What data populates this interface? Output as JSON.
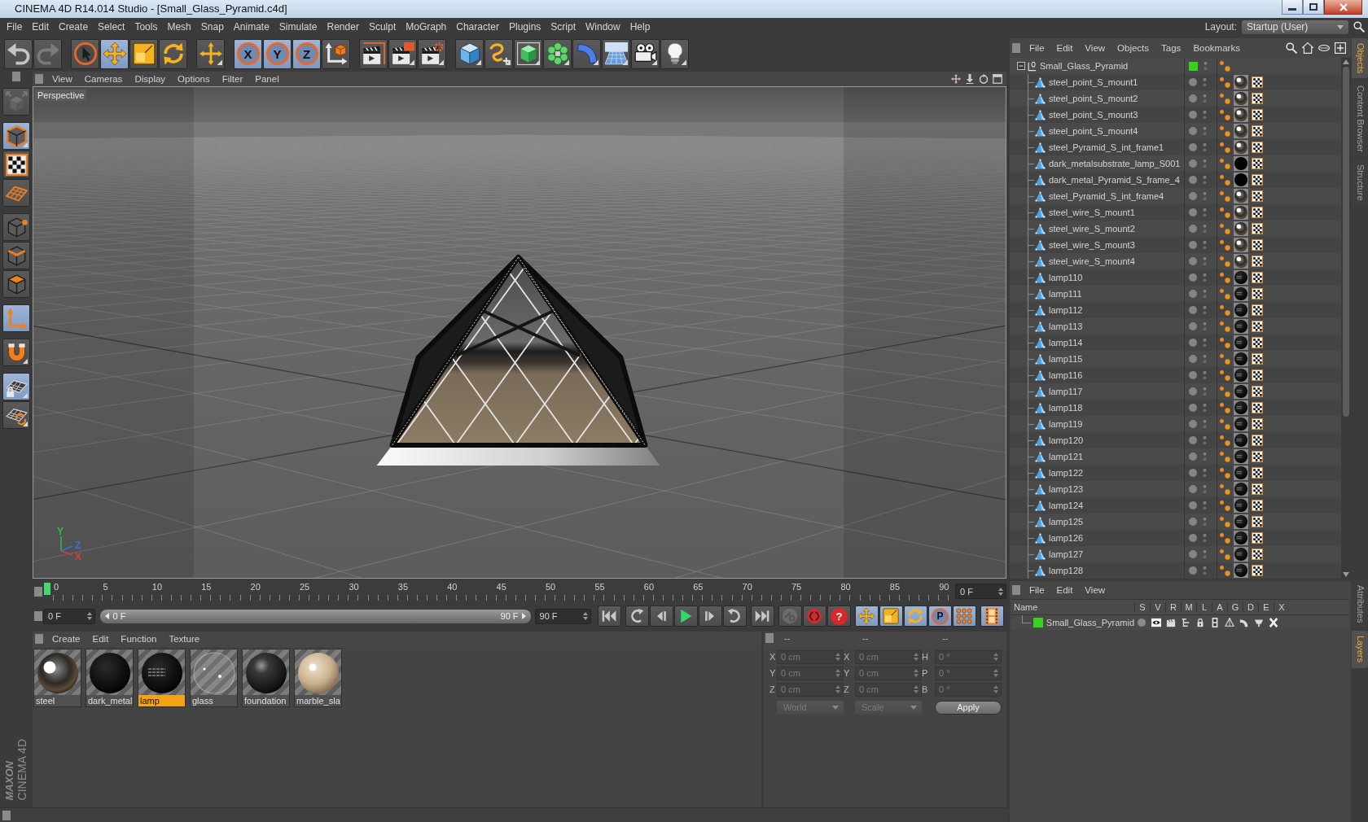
{
  "window": {
    "title": "CINEMA 4D R14.014 Studio - [Small_Glass_Pyramid.c4d]",
    "controls": [
      {
        "kind": "minimize"
      },
      {
        "kind": "maximize"
      },
      {
        "kind": "close"
      }
    ]
  },
  "menu_bar": [
    "File",
    "Edit",
    "Create",
    "Select",
    "Tools",
    "Mesh",
    "Snap",
    "Animate",
    "Simulate",
    "Render",
    "Sculpt",
    "MoGraph",
    "Character",
    "Plugins",
    "Script",
    "Window",
    "Help"
  ],
  "layout": {
    "label": "Layout:",
    "value": "Startup (User)"
  },
  "toolbar": [
    {
      "buttons": [
        {
          "kind": "undo",
          "active": false,
          "disabled": false
        },
        {
          "kind": "redo",
          "active": false,
          "disabled": true
        }
      ]
    },
    {
      "buttons": [
        {
          "kind": "select",
          "active": false,
          "disabled": false
        },
        {
          "kind": "move",
          "active": true,
          "disabled": false
        },
        {
          "kind": "scale",
          "active": false,
          "disabled": false
        },
        {
          "kind": "rotate",
          "active": false,
          "disabled": false
        }
      ]
    },
    {
      "buttons": [
        {
          "kind": "cross",
          "active": false,
          "disabled": false
        }
      ]
    },
    {
      "buttons": [
        {
          "kind": "axis",
          "label": "X",
          "active": true,
          "disabled": false
        },
        {
          "kind": "axis",
          "label": "Y",
          "active": true,
          "disabled": false
        },
        {
          "kind": "axis",
          "label": "Z",
          "active": true,
          "disabled": false
        },
        {
          "kind": "coords",
          "active": false,
          "disabled": false
        }
      ]
    },
    {
      "buttons": [
        {
          "kind": "renderview",
          "active": false,
          "disabled": false
        },
        {
          "kind": "renderpv",
          "active": false,
          "disabled": false
        },
        {
          "kind": "rendersettings",
          "active": false,
          "disabled": false
        }
      ]
    },
    {
      "buttons": [
        {
          "kind": "cube",
          "active": false,
          "disabled": false
        },
        {
          "kind": "pen",
          "active": false,
          "disabled": false
        },
        {
          "kind": "subdiv",
          "active": false,
          "disabled": false
        },
        {
          "kind": "cloner",
          "active": false,
          "disabled": false
        },
        {
          "kind": "bend",
          "active": false,
          "disabled": false
        },
        {
          "kind": "floor",
          "active": false,
          "disabled": false
        },
        {
          "kind": "camera",
          "active": false,
          "disabled": false
        },
        {
          "kind": "light",
          "active": false,
          "disabled": false
        }
      ]
    }
  ],
  "tools": [
    {
      "buttons": [
        {
          "kind": "editable",
          "active": false,
          "disabled": true
        }
      ]
    },
    {
      "buttons": [
        {
          "kind": "model",
          "active": true,
          "disabled": false
        },
        {
          "kind": "texture",
          "active": false,
          "disabled": false
        },
        {
          "kind": "workplane",
          "active": false,
          "disabled": false
        }
      ]
    },
    {
      "buttons": [
        {
          "kind": "points",
          "active": false,
          "disabled": false
        },
        {
          "kind": "edges",
          "active": false,
          "disabled": false
        },
        {
          "kind": "polygons",
          "active": false,
          "disabled": false
        }
      ]
    },
    {
      "buttons": [
        {
          "kind": "axismode",
          "active": true,
          "disabled": false
        }
      ]
    },
    {
      "buttons": [
        {
          "kind": "snap",
          "active": false,
          "disabled": false
        }
      ]
    },
    {
      "buttons": [
        {
          "kind": "planelock",
          "active": true,
          "disabled": false
        },
        {
          "kind": "planealign",
          "active": false,
          "disabled": false
        }
      ]
    }
  ],
  "viewport": {
    "menu": [
      "View",
      "Cameras",
      "Display",
      "Options",
      "Filter",
      "Panel"
    ],
    "nav": [
      {
        "kind": "pan"
      },
      {
        "kind": "dolly"
      },
      {
        "kind": "orbit"
      },
      {
        "kind": "maximize"
      }
    ],
    "camera": "Perspective",
    "axes": [
      {
        "label": "Y",
        "color": "#2fbf3a"
      },
      {
        "label": "Z",
        "color": "#3a6fe0"
      },
      {
        "label": "X",
        "color": "#e03a3a"
      }
    ]
  },
  "timeline": {
    "frames": [
      "0",
      "5",
      "10",
      "15",
      "20",
      "25",
      "30",
      "35",
      "40",
      "45",
      "50",
      "55",
      "60",
      "65",
      "70",
      "75",
      "80",
      "85",
      "90"
    ],
    "level": 0,
    "current": "0 F"
  },
  "transport": {
    "start": "0 F",
    "range": {
      "start": "0 F",
      "end": "90 F",
      "level": 1
    },
    "end": "90 F",
    "groups": [
      {
        "buttons": [
          {
            "kind": "tostart",
            "active": false,
            "disabled": false
          }
        ]
      },
      {
        "buttons": [
          {
            "kind": "prevkey",
            "active": false,
            "disabled": false
          },
          {
            "kind": "prevframe",
            "active": false,
            "disabled": false
          },
          {
            "kind": "play",
            "active": false,
            "disabled": false
          },
          {
            "kind": "nextframe",
            "active": false,
            "disabled": false
          },
          {
            "kind": "nextkey",
            "active": false,
            "disabled": false
          }
        ]
      },
      {
        "buttons": [
          {
            "kind": "toend",
            "active": false,
            "disabled": false
          }
        ]
      },
      {
        "buttons": [
          {
            "kind": "keysel",
            "active": false,
            "disabled": true
          },
          {
            "kind": "record",
            "active": false,
            "disabled": false
          },
          {
            "kind": "query",
            "label": "?",
            "active": false,
            "disabled": false
          }
        ]
      },
      {
        "buttons": [
          {
            "kind": "pos",
            "active": true,
            "disabled": false
          },
          {
            "kind": "scl",
            "active": true,
            "disabled": false
          },
          {
            "kind": "rot",
            "active": true,
            "disabled": false
          },
          {
            "kind": "param",
            "label": "P",
            "active": true,
            "disabled": false
          },
          {
            "kind": "pla",
            "active": true,
            "disabled": false
          }
        ]
      },
      {
        "buttons": [
          {
            "kind": "timeline",
            "active": true,
            "disabled": false
          }
        ]
      }
    ]
  },
  "materials": {
    "menu": [
      "Create",
      "Edit",
      "Function",
      "Texture"
    ],
    "items": [
      {
        "name": "steel",
        "kind": "steel",
        "selected": false
      },
      {
        "name": "dark_metal",
        "kind": "black",
        "selected": false
      },
      {
        "name": "lamp",
        "kind": "lamp",
        "selected": true
      },
      {
        "name": "glass",
        "kind": "glass",
        "selected": false
      },
      {
        "name": "foundation",
        "kind": "foundation",
        "selected": false
      },
      {
        "name": "marble_sla",
        "kind": "marble",
        "selected": false
      }
    ]
  },
  "coordinates": {
    "headers": [
      "--",
      "--",
      "--"
    ],
    "disabled": true,
    "rows": [
      [
        {
          "axis": "X",
          "value": "0 cm"
        },
        {
          "axis": "X",
          "value": "0 cm"
        },
        {
          "axis": "H",
          "value": "0 °"
        }
      ],
      [
        {
          "axis": "Y",
          "value": "0 cm"
        },
        {
          "axis": "Y",
          "value": "0 cm"
        },
        {
          "axis": "P",
          "value": "0 °"
        }
      ],
      [
        {
          "axis": "Z",
          "value": "0 cm"
        },
        {
          "axis": "Z",
          "value": "0 cm"
        },
        {
          "axis": "B",
          "value": "0 °"
        }
      ]
    ],
    "dropdowns": [
      "World",
      "Scale"
    ],
    "apply": "Apply"
  },
  "objects": {
    "menu": [
      "File",
      "Edit",
      "View",
      "Objects",
      "Tags",
      "Bookmarks"
    ],
    "icons": [
      {
        "kind": "search"
      },
      {
        "kind": "home"
      },
      {
        "kind": "lens"
      },
      {
        "kind": "newpanel"
      }
    ],
    "tree": [
      {
        "name": "Small_Glass_Pyramid",
        "expanded": true,
        "color": "#37d21b",
        "children": [
          {
            "name": "steel_point_S_mount1",
            "kind": "steel"
          },
          {
            "name": "steel_point_S_mount2",
            "kind": "steel"
          },
          {
            "name": "steel_point_S_mount3",
            "kind": "steel"
          },
          {
            "name": "steel_point_S_mount4",
            "kind": "steel"
          },
          {
            "name": "steel_Pyramid_S_int_frame1",
            "kind": "steel"
          },
          {
            "name": "dark_metalsubstrate_lamp_S001",
            "kind": "black"
          },
          {
            "name": "dark_metal_Pyramid_S_frame_4",
            "kind": "black"
          },
          {
            "name": "steel_Pyramid_S_int_frame4",
            "kind": "steel"
          },
          {
            "name": "steel_wire_S_mount1",
            "kind": "steel"
          },
          {
            "name": "steel_wire_S_mount2",
            "kind": "steel"
          },
          {
            "name": "steel_wire_S_mount3",
            "kind": "steel"
          },
          {
            "name": "steel_wire_S_mount4",
            "kind": "steel"
          },
          {
            "name": "lamp110",
            "kind": "lamp"
          },
          {
            "name": "lamp111",
            "kind": "lamp"
          },
          {
            "name": "lamp112",
            "kind": "lamp"
          },
          {
            "name": "lamp113",
            "kind": "lamp"
          },
          {
            "name": "lamp114",
            "kind": "lamp"
          },
          {
            "name": "lamp115",
            "kind": "lamp"
          },
          {
            "name": "lamp116",
            "kind": "lamp"
          },
          {
            "name": "lamp117",
            "kind": "lamp"
          },
          {
            "name": "lamp118",
            "kind": "lamp"
          },
          {
            "name": "lamp119",
            "kind": "lamp"
          },
          {
            "name": "lamp120",
            "kind": "lamp"
          },
          {
            "name": "lamp121",
            "kind": "lamp"
          },
          {
            "name": "lamp122",
            "kind": "lamp"
          },
          {
            "name": "lamp123",
            "kind": "lamp"
          },
          {
            "name": "lamp124",
            "kind": "lamp"
          },
          {
            "name": "lamp125",
            "kind": "lamp"
          },
          {
            "name": "lamp126",
            "kind": "lamp"
          },
          {
            "name": "lamp127",
            "kind": "lamp"
          },
          {
            "name": "lamp128",
            "kind": "lamp"
          }
        ]
      }
    ]
  },
  "layers": {
    "menu": [
      "File",
      "Edit",
      "View"
    ],
    "columns": [
      "Name",
      "S",
      "V",
      "R",
      "M",
      "L",
      "A",
      "G",
      "D",
      "E",
      "X"
    ],
    "rows": [
      {
        "name": "Small_Glass_Pyramid",
        "color": "#37d21b",
        "solo": false
      }
    ]
  },
  "side_tabs": {
    "top": [
      {
        "label": "Objects",
        "selected": true
      },
      {
        "label": "Content Browser",
        "selected": false
      },
      {
        "label": "Structure",
        "selected": false
      }
    ],
    "bottom": [
      {
        "label": "Attributes",
        "selected": false
      },
      {
        "label": "Layers",
        "selected": true
      }
    ]
  },
  "logo": {
    "brand": "MAXON",
    "product": "CINEMA 4D"
  }
}
